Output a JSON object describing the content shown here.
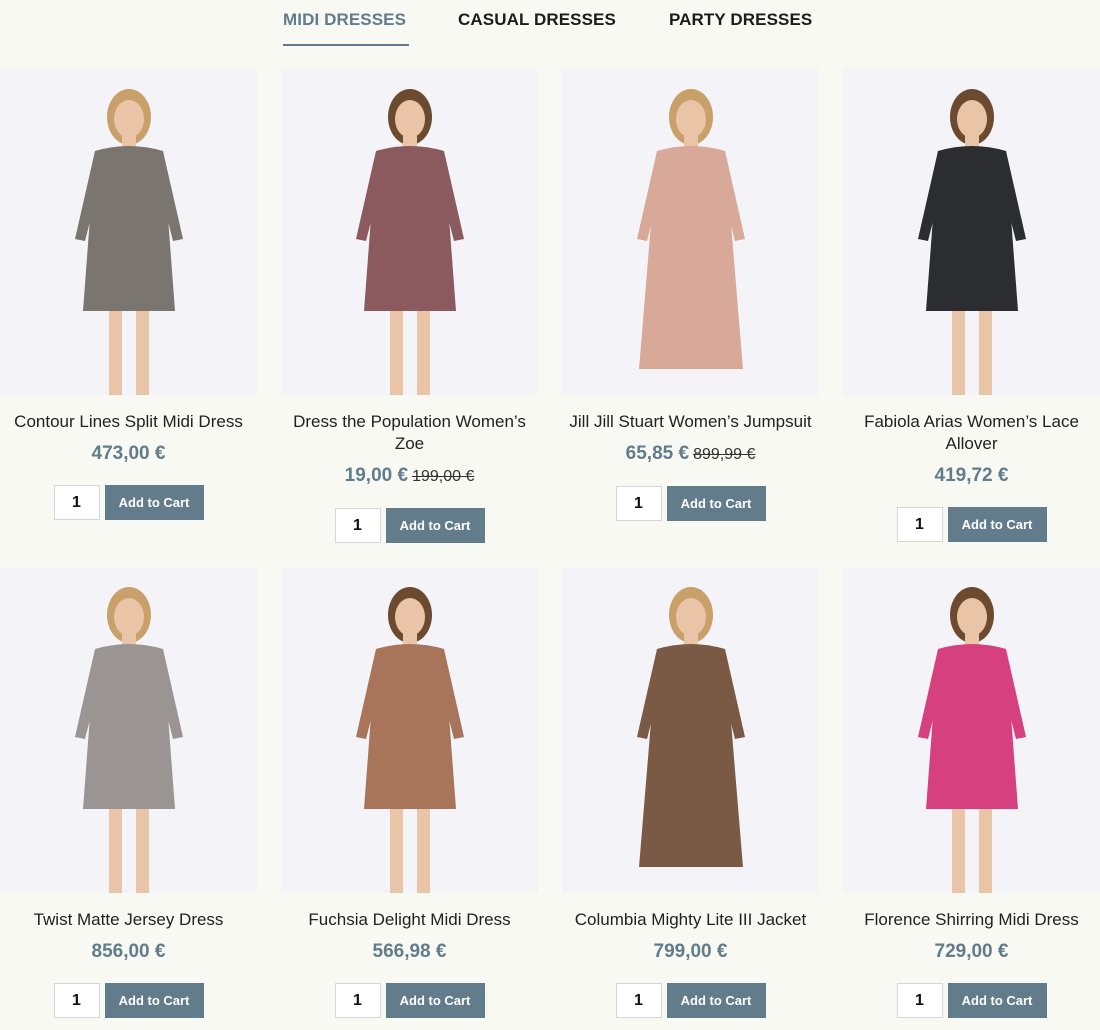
{
  "tabs": [
    {
      "label": "MIDI DRESSES",
      "active": true
    },
    {
      "label": "CASUAL DRESSES",
      "active": false
    },
    {
      "label": "PARTY DRESSES",
      "active": false
    }
  ],
  "cart_label": "Add to Cart",
  "products": [
    {
      "name": "Contour Lines Split Midi Dress",
      "price": "473,00 €",
      "old_price": "",
      "qty": "1",
      "garment_color": "#7b7570"
    },
    {
      "name": "Dress the Population Women’s Zoe",
      "price": "19,00 €",
      "old_price": "199,00 €",
      "qty": "1",
      "garment_color": "#8a5a5e"
    },
    {
      "name": "Jill Jill Stuart Women’s Jumpsuit",
      "price": "65,85 €",
      "old_price": "899,99 €",
      "qty": "1",
      "garment_color": "#d8a898"
    },
    {
      "name": "Fabiola Arias Women’s Lace Allover",
      "price": "419,72 €",
      "old_price": "",
      "qty": "1",
      "garment_color": "#2b2d31"
    },
    {
      "name": "Twist Matte Jersey Dress",
      "price": "856,00 €",
      "old_price": "",
      "qty": "1",
      "garment_color": "#9a9592"
    },
    {
      "name": "Fuchsia Delight Midi Dress",
      "price": "566,98 €",
      "old_price": "",
      "qty": "1",
      "garment_color": "#a8755a"
    },
    {
      "name": "Columbia Mighty Lite III Jacket",
      "price": "799,00 €",
      "old_price": "",
      "qty": "1",
      "garment_color": "#7a5a44"
    },
    {
      "name": "Florence Shirring Midi Dress",
      "price": "729,00 €",
      "old_price": "",
      "qty": "1",
      "garment_color": "#d6407f"
    }
  ]
}
